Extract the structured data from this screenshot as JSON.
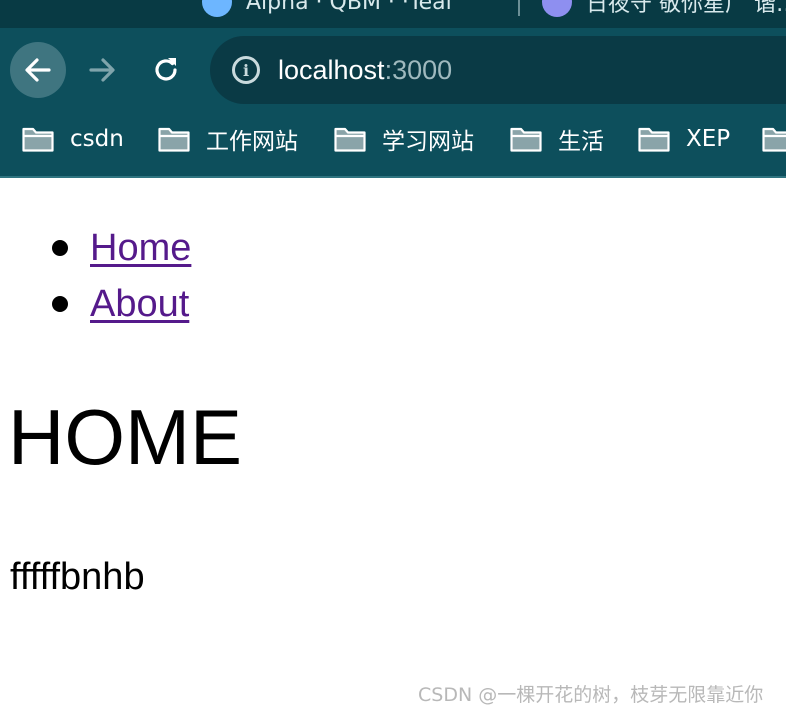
{
  "browser": {
    "tabs": [
      {
        "label": "Alpha · QBM · ·Teal"
      },
      {
        "label": "日夜守 敬你星广 谐…"
      }
    ],
    "address_bar": {
      "host": "localhost",
      "port": ":3000"
    },
    "bookmarks": [
      {
        "label": "csdn"
      },
      {
        "label": "工作网站"
      },
      {
        "label": "学习网站"
      },
      {
        "label": "生活"
      },
      {
        "label": "XEP"
      }
    ],
    "colors": {
      "frame": "#0d4f5c",
      "omnibox": "#0a3a45",
      "link": "#551a8b"
    }
  },
  "page": {
    "nav": [
      {
        "label": "Home"
      },
      {
        "label": "About"
      }
    ],
    "heading": "HOME",
    "paragraph": "fffffbnhb"
  },
  "watermark": "CSDN @一棵开花的树，枝芽无限靠近你"
}
